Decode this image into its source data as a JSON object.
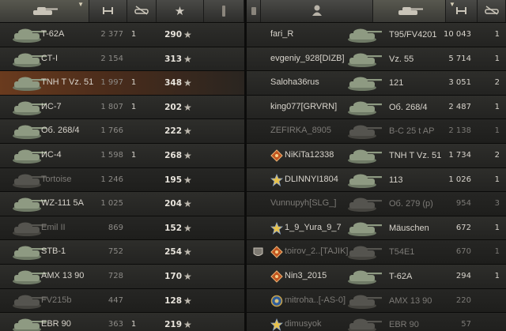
{
  "left_rows": [
    {
      "vehicle": "T-62A",
      "xp": "2 377",
      "kills": "1",
      "damage": "290",
      "state": "alive"
    },
    {
      "vehicle": "СТ-I",
      "xp": "2 154",
      "kills": "",
      "damage": "313",
      "state": "alive"
    },
    {
      "vehicle": "TNH T Vz. 51",
      "xp": "1 997",
      "kills": "1",
      "damage": "348",
      "state": "highlight"
    },
    {
      "vehicle": "ИС-7",
      "xp": "1 807",
      "kills": "1",
      "damage": "202",
      "state": "alive"
    },
    {
      "vehicle": "Об. 268/4",
      "xp": "1 766",
      "kills": "",
      "damage": "222",
      "state": "alive"
    },
    {
      "vehicle": "ИС-4",
      "xp": "1 598",
      "kills": "1",
      "damage": "268",
      "state": "alive"
    },
    {
      "vehicle": "Tortoise",
      "xp": "1 246",
      "kills": "",
      "damage": "195",
      "state": "dead"
    },
    {
      "vehicle": "WZ-111 5A",
      "xp": "1 025",
      "kills": "",
      "damage": "204",
      "state": "alive"
    },
    {
      "vehicle": "Emil II",
      "xp": "869",
      "kills": "",
      "damage": "152",
      "state": "dead"
    },
    {
      "vehicle": "STB-1",
      "xp": "752",
      "kills": "",
      "damage": "254",
      "state": "alive"
    },
    {
      "vehicle": "AMX 13 90",
      "xp": "728",
      "kills": "",
      "damage": "170",
      "state": "alive"
    },
    {
      "vehicle": "FV215b",
      "xp": "447",
      "kills": "",
      "damage": "128",
      "state": "dead"
    },
    {
      "vehicle": "EBR 90",
      "xp": "363",
      "kills": "1",
      "damage": "219",
      "state": "alive"
    }
  ],
  "right_rows": [
    {
      "player": "fari_R",
      "vehicle": "T95/FV4201",
      "damage": "10 043",
      "kills": "1",
      "state": "alive",
      "badge": ""
    },
    {
      "player": "evgeniy_928[DIZB]",
      "vehicle": "Vz. 55",
      "damage": "5 714",
      "kills": "1",
      "state": "alive",
      "badge": ""
    },
    {
      "player": "Saloha36rus",
      "vehicle": "121",
      "damage": "3 051",
      "kills": "2",
      "state": "alive",
      "badge": ""
    },
    {
      "player": "king077[GRVRN]",
      "vehicle": "Об. 268/4",
      "damage": "2 487",
      "kills": "1",
      "state": "alive",
      "badge": ""
    },
    {
      "player": "ZEFIRKA_8905",
      "vehicle": "B-C 25 t AP",
      "damage": "2 138",
      "kills": "1",
      "state": "dead",
      "badge": ""
    },
    {
      "player": "NiKiTa12338",
      "vehicle": "TNH T Vz. 51",
      "damage": "1 734",
      "kills": "2",
      "state": "alive",
      "badge": "orange-diamond"
    },
    {
      "player": "DLINNYI1804",
      "vehicle": "113",
      "damage": "1 026",
      "kills": "1",
      "state": "alive",
      "badge": "gold-star"
    },
    {
      "player": "Vunnupyh[SLG_]",
      "vehicle": "Об. 279 (р)",
      "damage": "954",
      "kills": "3",
      "state": "dead",
      "badge": ""
    },
    {
      "player": "1_9_Yura_9_7",
      "vehicle": "Mäuschen",
      "damage": "672",
      "kills": "1",
      "state": "alive",
      "badge": "gold-star"
    },
    {
      "player": "toirov_2..[TAJIK]",
      "vehicle": "T54E1",
      "damage": "670",
      "kills": "1",
      "state": "dead",
      "badge": "orange-diamond",
      "chip": true
    },
    {
      "player": "Nin3_2015",
      "vehicle": "T-62A",
      "damage": "294",
      "kills": "1",
      "state": "alive",
      "badge": "orange-diamond"
    },
    {
      "player": "mitroha..[-AS-0]",
      "vehicle": "AMX 13 90",
      "damage": "220",
      "kills": "",
      "state": "dead",
      "badge": "clan-emblem"
    },
    {
      "player": "dimusyok",
      "vehicle": "EBR 90",
      "damage": "57",
      "kills": "",
      "state": "dead",
      "badge": "gold-star"
    }
  ],
  "icons": {
    "tank_header": "tank-icon",
    "sort": "sort-chevron-icon",
    "xp": "xp-icon",
    "frags": "destroyed-tank-icon",
    "star": "star-icon",
    "player": "player-icon",
    "damage": "damage-icon"
  },
  "header": {
    "star_glyph": "★"
  }
}
